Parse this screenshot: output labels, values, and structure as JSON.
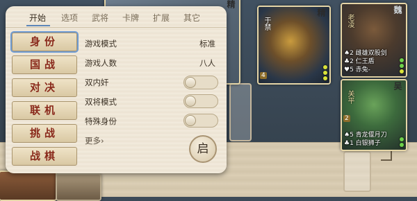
{
  "menu": {
    "tabs": [
      {
        "label": "开始",
        "active": true
      },
      {
        "label": "选项",
        "active": false
      },
      {
        "label": "武将",
        "active": false
      },
      {
        "label": "卡牌",
        "active": false
      },
      {
        "label": "扩展",
        "active": false
      },
      {
        "label": "其它",
        "active": false
      }
    ],
    "modes": [
      "身份",
      "国战",
      "对决",
      "联机",
      "挑战",
      "战棋"
    ],
    "selected_mode": "身份",
    "options": [
      {
        "label": "游戏模式",
        "value": "标准"
      },
      {
        "label": "游戏人数",
        "value": "八人"
      },
      {
        "label": "双内奸",
        "toggle": false
      },
      {
        "label": "双将模式",
        "toggle": false
      },
      {
        "label": "特殊身份",
        "toggle": false
      }
    ],
    "more_label": "更多›",
    "start_label": "启"
  },
  "cards": {
    "left_top_kingdom": "精",
    "center": {
      "kingdom": "精",
      "name": "于禁",
      "count": "4"
    },
    "right_top": {
      "kingdom": "魏",
      "name": "老凌",
      "equip": [
        "♠2 雌雄双股剑",
        "♣2 仁王盾",
        "♥5 赤兔-"
      ]
    },
    "right_bottom": {
      "kingdom": "吴",
      "name": "关平",
      "count": "2",
      "equip": [
        "♠5 青龙偃月刀",
        "♣1 白银狮子"
      ]
    }
  },
  "colors": {
    "accent": "#5d86b8",
    "mode_text": "#8a2a1c",
    "hp_yellow": "#d8e23a",
    "hp_green": "#6fd24a"
  }
}
